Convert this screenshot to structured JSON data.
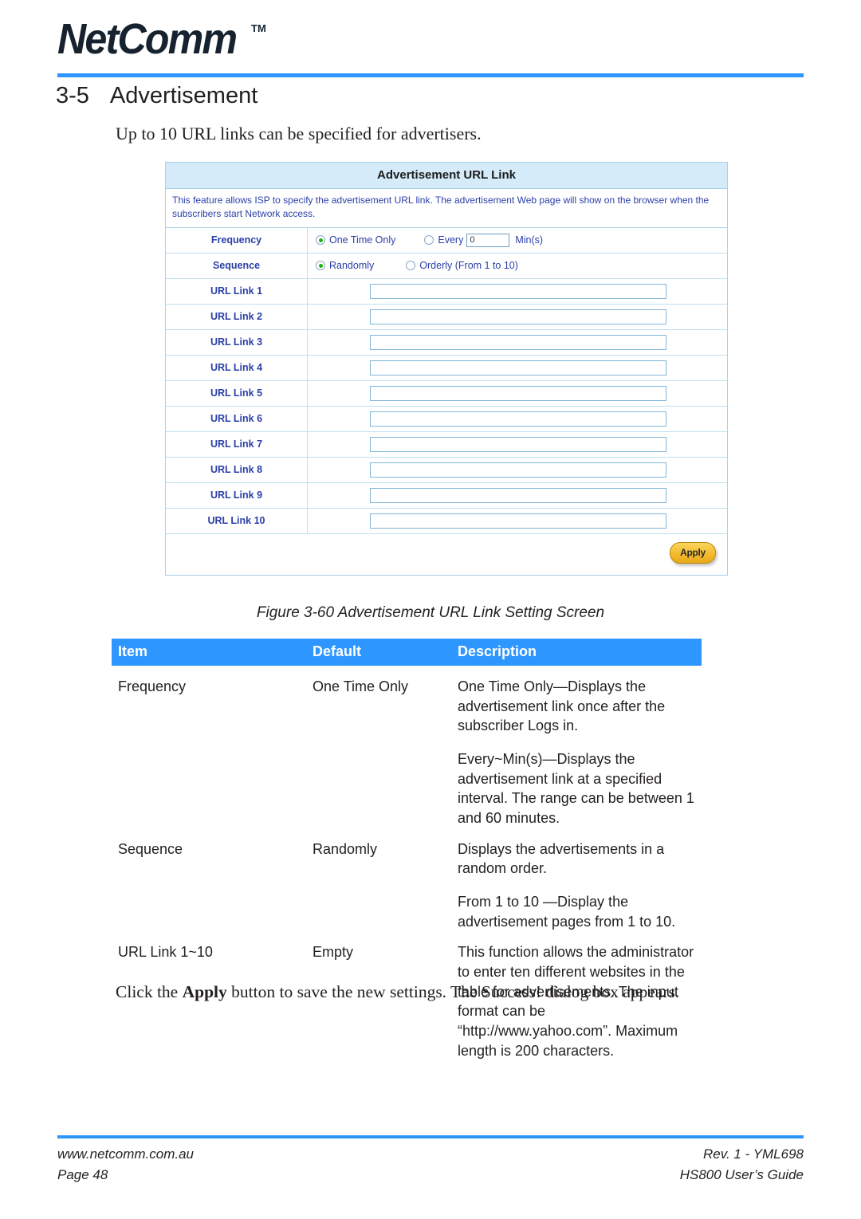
{
  "brand": {
    "logo_text": "NetComm",
    "trademark": "TM"
  },
  "section": {
    "number": "3-5",
    "title": "Advertisement",
    "intro": "Up to 10 URL links can be specified for advertisers."
  },
  "form": {
    "title": "Advertisement URL Link",
    "note": "This feature allows ISP to specify the advertisement URL link. The advertisement Web page will show on the browser when the subscribers start Network access.",
    "frequency": {
      "label": "Frequency",
      "option_one_time": "One Time Only",
      "option_every": "Every",
      "every_value": "0",
      "mins_suffix": "Min(s)"
    },
    "sequence": {
      "label": "Sequence",
      "option_randomly": "Randomly",
      "option_orderly": "Orderly (From 1 to 10)"
    },
    "url_links": [
      {
        "label": "URL Link 1",
        "value": ""
      },
      {
        "label": "URL Link 2",
        "value": ""
      },
      {
        "label": "URL Link 3",
        "value": ""
      },
      {
        "label": "URL Link 4",
        "value": ""
      },
      {
        "label": "URL Link 5",
        "value": ""
      },
      {
        "label": "URL Link 6",
        "value": ""
      },
      {
        "label": "URL Link 7",
        "value": ""
      },
      {
        "label": "URL Link 8",
        "value": ""
      },
      {
        "label": "URL Link 9",
        "value": ""
      },
      {
        "label": "URL Link 10",
        "value": ""
      }
    ],
    "apply_label": "Apply"
  },
  "figure": {
    "caption": "Figure 3-60 Advertisement URL Link Setting Screen"
  },
  "table": {
    "headers": {
      "item": "Item",
      "default": "Default",
      "description": "Description"
    },
    "rows": [
      {
        "item": "Frequency",
        "default": "One Time Only",
        "description": [
          "One Time Only—Displays the advertisement link  once after the subscriber Logs in.",
          "Every~Min(s)—Displays the advertisement link at a specified interval. The range can be between 1 and 60 minutes."
        ]
      },
      {
        "item": "Sequence",
        "default": "Randomly",
        "description": [
          "Displays the advertisements in a random order.",
          "From 1 to 10 —Display the advertisement pages from 1 to 10."
        ]
      },
      {
        "item": "URL Link 1~10",
        "default": "Empty",
        "description": [
          "This function allows the administrator to enter ten different websites in the table for advertisements.   The input format can be “http://www.yahoo.com”. Maximum length is 200 characters."
        ]
      }
    ]
  },
  "closing": {
    "before_bold": "Click the ",
    "bold": "Apply",
    "after_bold": " button to save the new settings. The Success! dialog box appears."
  },
  "footer": {
    "website": "www.netcomm.com.au",
    "page": "Page 48",
    "revision": "Rev. 1 - YML698",
    "guide": "HS800 User’s Guide"
  },
  "colors": {
    "accent_blue": "#2e96ff",
    "form_header_blue": "#d5ebf9",
    "form_border": "#a9cfe8",
    "label_blue": "#2b3fa8",
    "apply_gold": "#f3bc2e",
    "radio_green": "#17b417"
  }
}
